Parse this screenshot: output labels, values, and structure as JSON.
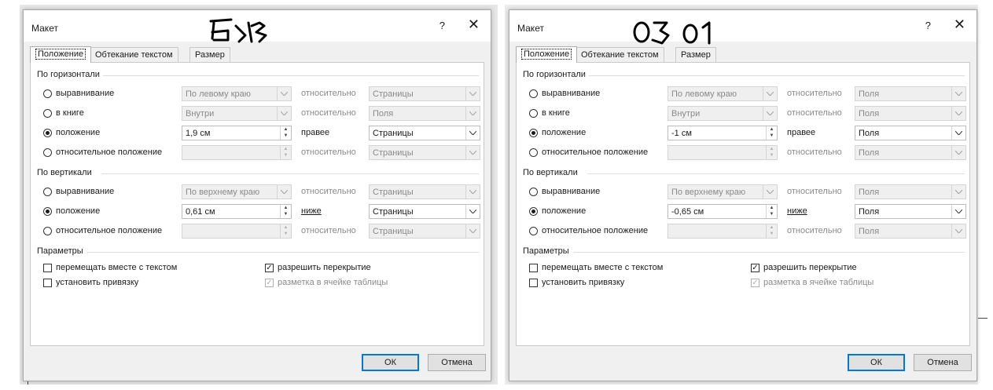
{
  "dialogs": [
    {
      "title": "Макет",
      "help": "?",
      "close": "✕",
      "tabs": [
        "Положение",
        "Обтекание текстом",
        "Размер"
      ],
      "horizontal_group": "По горизонтали",
      "vertical_group": "По вертикали",
      "options_group": "Параметры",
      "h_rows": [
        {
          "label": "выравнивание",
          "value": "По левому краю",
          "rel": "относительно",
          "target": "Страницы"
        },
        {
          "label": "в книге",
          "value": "Внутри",
          "rel": "относительно",
          "target": "Поля"
        },
        {
          "label": "положение",
          "value": "1,9 см",
          "rel": "правее",
          "target": "Страницы"
        },
        {
          "label": "относительное положение",
          "value": "",
          "rel": "относительно",
          "target": "Страницы"
        }
      ],
      "v_rows": [
        {
          "label": "выравнивание",
          "value": "По верхнему краю",
          "rel": "относительно",
          "target": "Страницы"
        },
        {
          "label": "положение",
          "value": "0,61 см",
          "rel": "ниже",
          "target": "Страницы"
        },
        {
          "label": "относительное положение",
          "value": "",
          "rel": "относительно",
          "target": "Страницы"
        }
      ],
      "options": {
        "move_with_text": "перемещать вместе с текстом",
        "lock_anchor": "установить привязку",
        "allow_overlap": "разрешить перекрытие",
        "table_cell_layout": "разметка в ячейке таблицы"
      },
      "buttons": {
        "ok": "ОК",
        "cancel": "Отмена"
      }
    },
    {
      "title": "Макет",
      "help": "?",
      "close": "✕",
      "tabs": [
        "Положение",
        "Обтекание текстом",
        "Размер"
      ],
      "horizontal_group": "По горизонтали",
      "vertical_group": "По вертикали",
      "options_group": "Параметры",
      "h_rows": [
        {
          "label": "выравнивание",
          "value": "По левому краю",
          "rel": "относительно",
          "target": "Поля"
        },
        {
          "label": "в книге",
          "value": "Внутри",
          "rel": "относительно",
          "target": "Поля"
        },
        {
          "label": "положение",
          "value": "-1 см",
          "rel": "правее",
          "target": "Поля"
        },
        {
          "label": "относительное положение",
          "value": "",
          "rel": "относительно",
          "target": "Поля"
        }
      ],
      "v_rows": [
        {
          "label": "выравнивание",
          "value": "По верхнему краю",
          "rel": "относительно",
          "target": "Поля"
        },
        {
          "label": "положение",
          "value": "-0,65 см",
          "rel": "ниже",
          "target": "Поля"
        },
        {
          "label": "относительное положение",
          "value": "",
          "rel": "относительно",
          "target": "Поля"
        }
      ],
      "options": {
        "move_with_text": "перемещать вместе с текстом",
        "lock_anchor": "установить привязку",
        "allow_overlap": "разрешить перекрытие",
        "table_cell_layout": "разметка в ячейке таблицы"
      },
      "buttons": {
        "ok": "ОК",
        "cancel": "Отмена"
      }
    }
  ],
  "colors": {
    "default_button_border": "#0078d7",
    "dialog_bg": "#f0f0f0",
    "panel_bg": "#ffffff"
  },
  "icons": [
    "help-icon",
    "close-icon",
    "chevron-down-icon",
    "spin-arrows-icon",
    "handwritten-annotation"
  ]
}
